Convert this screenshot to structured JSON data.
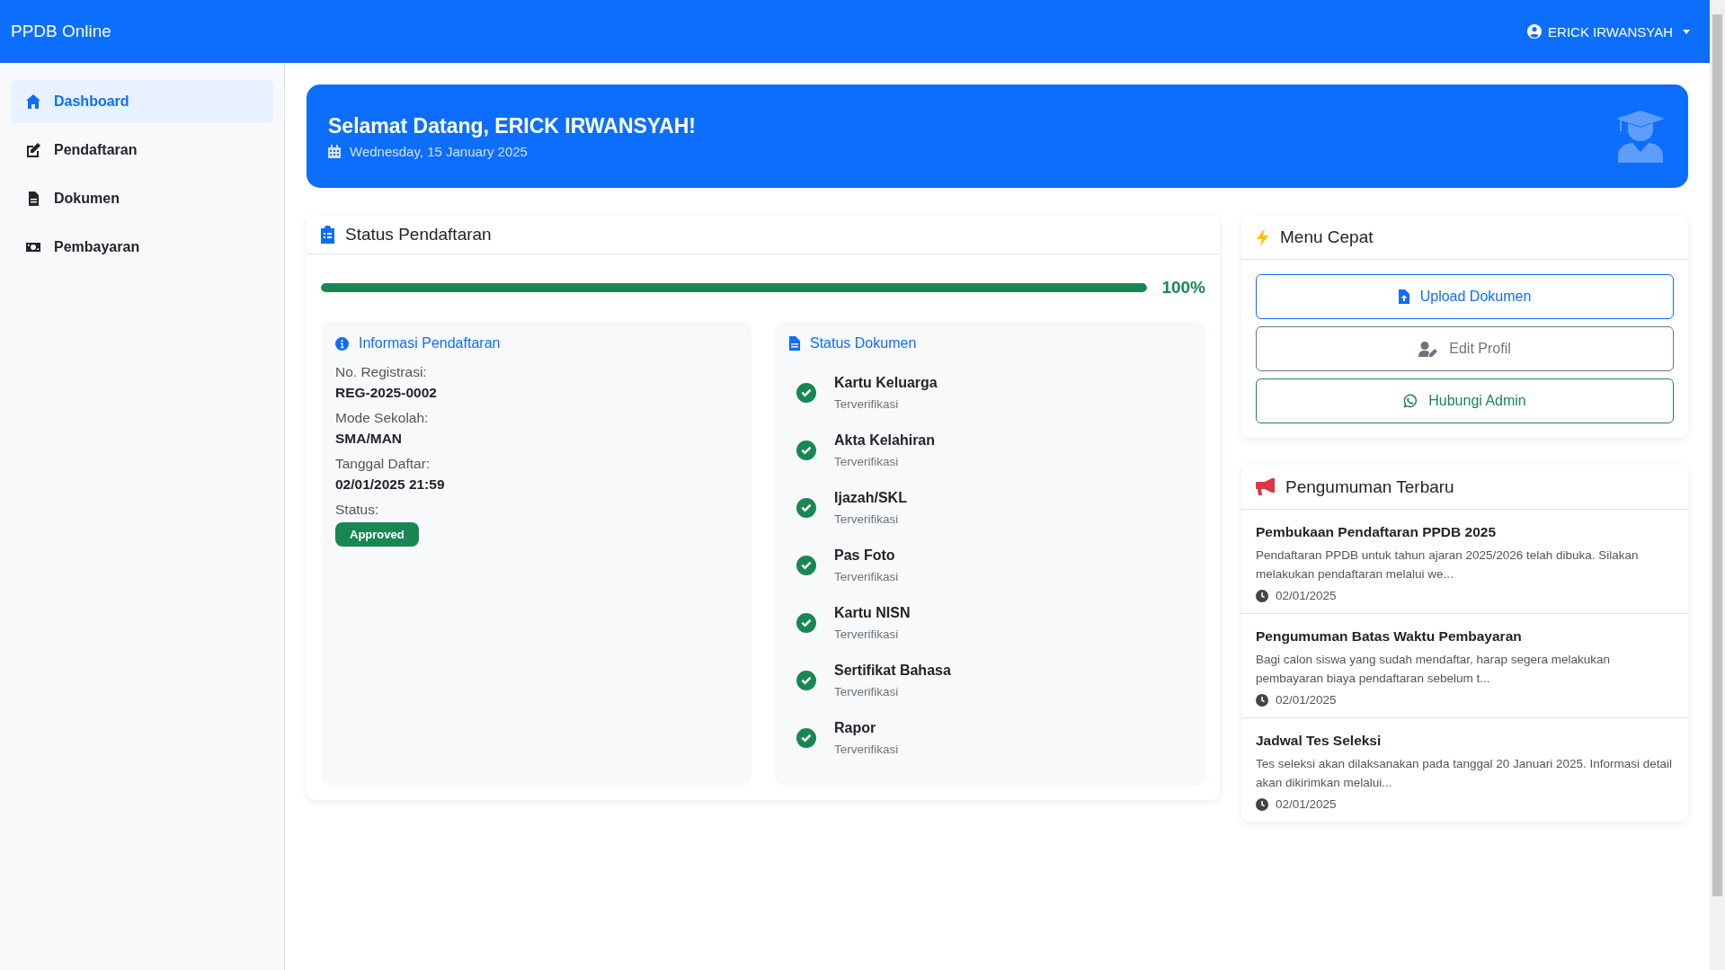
{
  "navbar": {
    "brand": "PPDB Online",
    "user": "ERICK IRWANSYAH"
  },
  "sidebar": {
    "items": [
      {
        "label": "Dashboard",
        "kind": "home",
        "selected": true
      },
      {
        "label": "Pendaftaran",
        "kind": "edit",
        "selected": false
      },
      {
        "label": "Dokumen",
        "kind": "file",
        "selected": false
      },
      {
        "label": "Pembayaran",
        "kind": "money",
        "selected": false
      }
    ]
  },
  "welcome": {
    "title": "Selamat Datang, ERICK IRWANSYAH!",
    "date": "Wednesday, 15 January 2025"
  },
  "status_pendaftaran": {
    "title": "Status Pendaftaran",
    "progress": {
      "level": 1,
      "reading": "100%"
    },
    "info": {
      "title": "Informasi Pendaftaran",
      "fields": [
        {
          "label": "No. Registrasi:",
          "value": "REG-2025-0002"
        },
        {
          "label": "Mode Sekolah:",
          "value": "SMA/MAN"
        },
        {
          "label": "Tanggal Daftar:",
          "value": "02/01/2025 21:59"
        }
      ],
      "status_label": "Status:",
      "status_badge": {
        "text": "Approved",
        "kind": "success"
      }
    },
    "documents": {
      "title": "Status Dokumen",
      "items": [
        {
          "name": "Kartu Keluarga",
          "status": "Terverifikasi",
          "verified": true
        },
        {
          "name": "Akta Kelahiran",
          "status": "Terverifikasi",
          "verified": true
        },
        {
          "name": "Ijazah/SKL",
          "status": "Terverifikasi",
          "verified": true
        },
        {
          "name": "Pas Foto",
          "status": "Terverifikasi",
          "verified": true
        },
        {
          "name": "Kartu NISN",
          "status": "Terverifikasi",
          "verified": true
        },
        {
          "name": "Sertifikat Bahasa",
          "status": "Terverifikasi",
          "verified": true
        },
        {
          "name": "Rapor",
          "status": "Terverifikasi",
          "verified": true
        }
      ]
    }
  },
  "menu_cepat": {
    "title": "Menu Cepat",
    "buttons": [
      {
        "label": "Upload Dokumen",
        "kind": "upload"
      },
      {
        "label": "Edit Profil",
        "kind": "profile"
      },
      {
        "label": "Hubungi Admin",
        "kind": "whatsapp"
      }
    ]
  },
  "pengumuman": {
    "title": "Pengumuman Terbaru",
    "items": [
      {
        "title": "Pembukaan Pendaftaran PPDB 2025",
        "text": "Pendaftaran PPDB untuk tahun ajaran 2025/2026 telah dibuka. Silakan melakukan pendaftaran melalui we...",
        "date": "02/01/2025"
      },
      {
        "title": "Pengumuman Batas Waktu Pembayaran",
        "text": "Bagi calon siswa yang sudah mendaftar, harap segera melakukan pembayaran biaya pendaftaran sebelum t...",
        "date": "02/01/2025"
      },
      {
        "title": "Jadwal Tes Seleksi",
        "text": "Tes seleksi akan dilaksanakan pada tanggal 20 Januari 2025. Informasi detail akan dikirimkan melalui...",
        "date": "02/01/2025"
      }
    ]
  }
}
